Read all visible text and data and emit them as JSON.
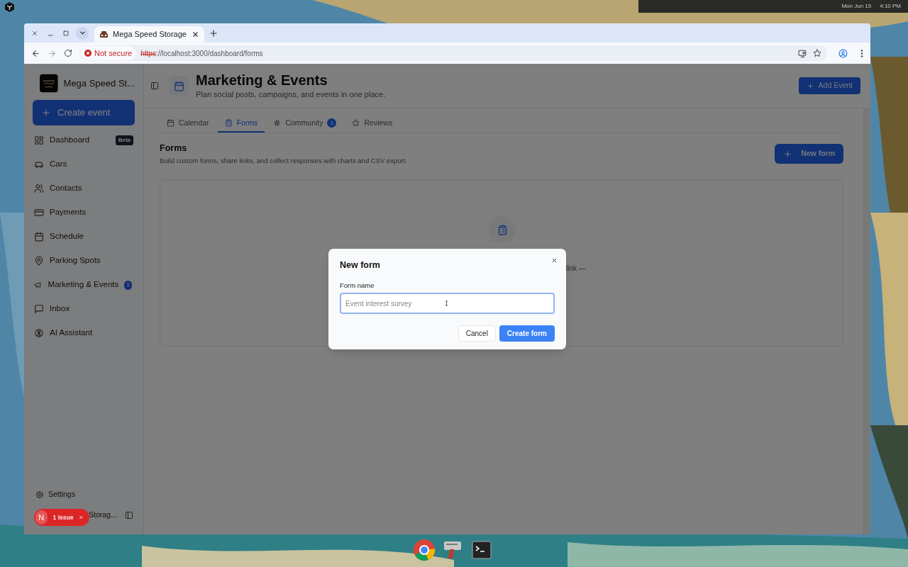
{
  "desktop": {
    "top_bar": {
      "date": "Mon Jun 15",
      "time": "4:10 PM"
    }
  },
  "browser": {
    "tab_title": "Mega Speed Storage",
    "security": "Not secure",
    "url": {
      "scheme": "https",
      "rest": "://localhost:3000/dashboard/forms"
    }
  },
  "sidebar": {
    "brand": "Mega Speed St...",
    "create_button": "Create event",
    "items": [
      {
        "label": "Dashboard",
        "badge": "Beta"
      },
      {
        "label": "Cars"
      },
      {
        "label": "Contacts"
      },
      {
        "label": "Payments"
      },
      {
        "label": "Schedule"
      },
      {
        "label": "Parking Spots"
      },
      {
        "label": "Marketing & Events",
        "count": "1"
      },
      {
        "label": "Inbox"
      },
      {
        "label": "AI Assistant"
      }
    ],
    "settings": "Settings",
    "footer_name": "Storag..."
  },
  "issue_pill": {
    "avatar": "N",
    "label": "1 Issue"
  },
  "header": {
    "title": "Marketing & Events",
    "subtitle": "Plan social posts, campaigns, and events in one place.",
    "add_button": "Add Event"
  },
  "tabs": [
    {
      "label": "Calendar",
      "selected": false
    },
    {
      "label": "Forms",
      "selected": true
    },
    {
      "label": "Community",
      "selected": false,
      "count": "1"
    },
    {
      "label": "Reviews",
      "selected": false
    }
  ],
  "section": {
    "title": "Forms",
    "description": "Build custom forms, share links, and collect responses with charts and CSV export.",
    "new_button": "New form"
  },
  "empty_state": {
    "text_fragment": "link —"
  },
  "dialog": {
    "title": "New form",
    "field_label": "Form name",
    "placeholder": "Event interest survey",
    "cancel": "Cancel",
    "submit": "Create form"
  }
}
